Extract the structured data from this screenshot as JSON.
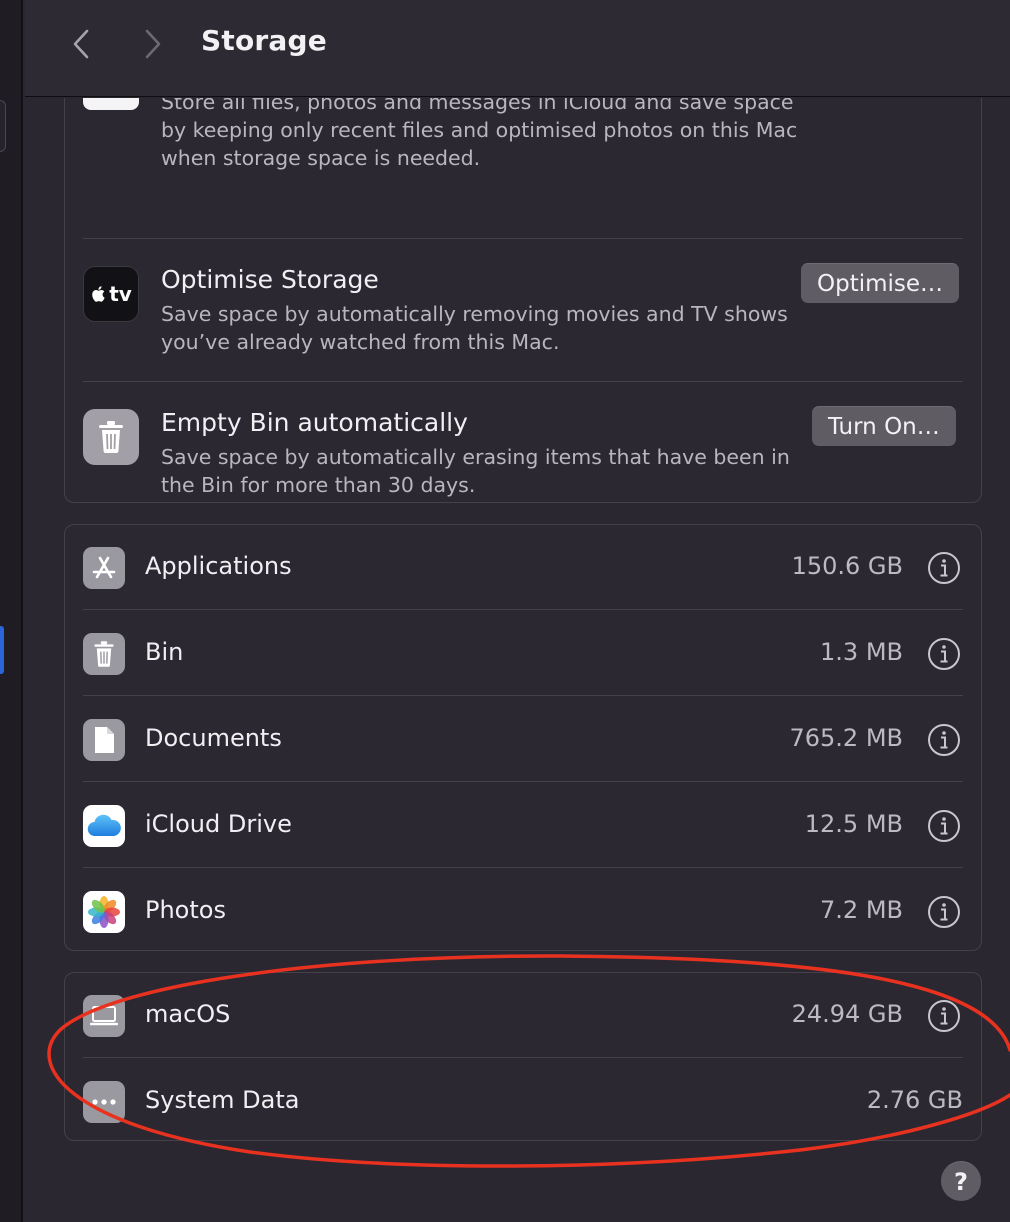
{
  "window": {
    "title": "Storage"
  },
  "recommendations": [
    {
      "name": "",
      "description": "Store all files, photos and messages in iCloud and save space by keeping only recent files and optimised photos on this Mac when storage space is needed.",
      "icon": "icloud-icon"
    },
    {
      "name": "Optimise Storage",
      "description": "Save space by automatically removing movies and TV shows you’ve already watched from this Mac.",
      "button": "Optimise…",
      "icon": "apple-tv-icon",
      "icon_text": "tv"
    },
    {
      "name": "Empty Bin automatically",
      "description": "Save space by automatically erasing items that have been in the Bin for more than 30 days.",
      "button": "Turn On…",
      "icon": "bin-icon"
    }
  ],
  "categories": [
    {
      "label": "Applications",
      "size": "150.6 GB",
      "icon": "app-store-icon"
    },
    {
      "label": "Bin",
      "size": "1.3 MB",
      "icon": "bin-icon"
    },
    {
      "label": "Documents",
      "size": "765.2 MB",
      "icon": "document-icon"
    },
    {
      "label": "iCloud Drive",
      "size": "12.5 MB",
      "icon": "icloud-drive-icon"
    },
    {
      "label": "Photos",
      "size": "7.2 MB",
      "icon": "photos-icon"
    }
  ],
  "system": [
    {
      "label": "macOS",
      "size": "24.94 GB",
      "icon": "macos-icon"
    },
    {
      "label": "System Data",
      "size": "2.76 GB",
      "icon": "more-icon"
    }
  ],
  "help": {
    "label": "?"
  },
  "colors": {
    "background": "#2b2731",
    "button": "#5f5c63",
    "annotation": "#e8321f",
    "accent": "#2a66d9"
  }
}
